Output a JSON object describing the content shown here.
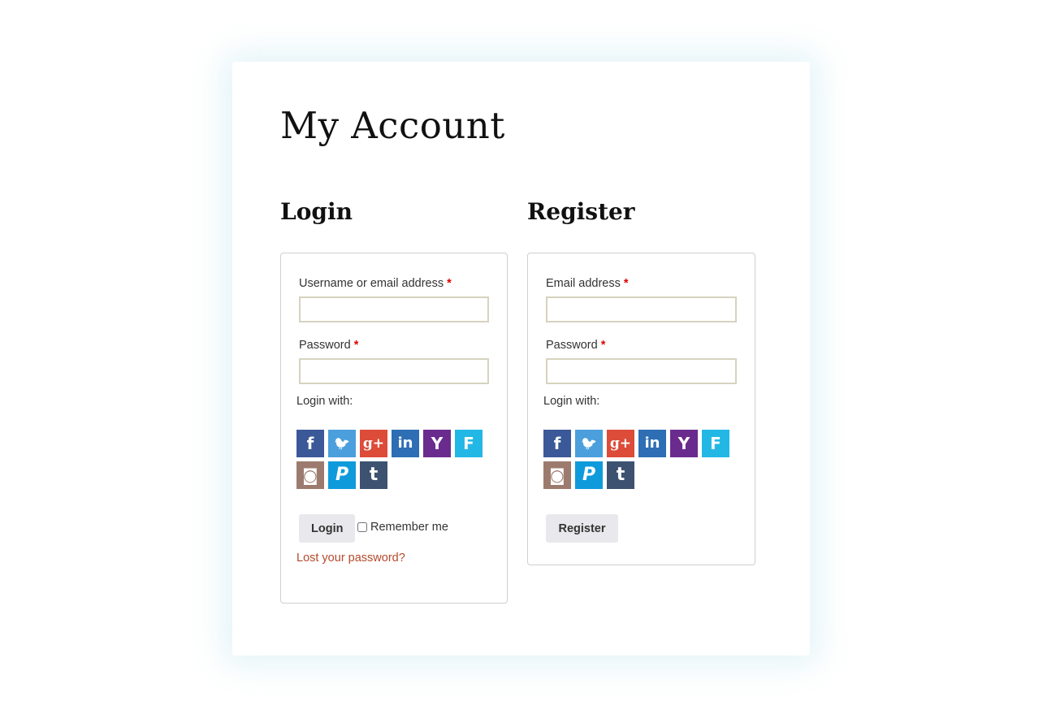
{
  "page": {
    "title": "My Account"
  },
  "login": {
    "heading": "Login",
    "username_label": "Username or email address",
    "username_value": "",
    "password_label": "Password",
    "password_value": "",
    "required_marker": "*",
    "login_with_label": "Login with:",
    "button_label": "Login",
    "remember_label": "Remember me",
    "remember_checked": false,
    "lost_password_link": "Lost your password?"
  },
  "register": {
    "heading": "Register",
    "email_label": "Email address",
    "email_value": "",
    "password_label": "Password",
    "password_value": "",
    "required_marker": "*",
    "login_with_label": "Login with:",
    "button_label": "Register"
  },
  "social_providers": [
    {
      "name": "facebook",
      "glyph": "f",
      "color": "#3b5998"
    },
    {
      "name": "twitter",
      "glyph": "🐦",
      "color": "#4a9fdc"
    },
    {
      "name": "google-plus",
      "glyph": "g+",
      "color": "#dd4b39"
    },
    {
      "name": "linkedin",
      "glyph": "in",
      "color": "#2d6eb4"
    },
    {
      "name": "yahoo",
      "glyph": "Y",
      "color": "#6a2b8e"
    },
    {
      "name": "foursquare",
      "glyph": "F",
      "color": "#23b7e5"
    },
    {
      "name": "instagram",
      "glyph": "◙",
      "color": "#9c7b6e"
    },
    {
      "name": "paypal",
      "glyph": "P",
      "color": "#0f9bdb"
    },
    {
      "name": "tumblr",
      "glyph": "t",
      "color": "#3c5270"
    }
  ],
  "colors": {
    "link": "#b5492c",
    "required": "#e00000",
    "button_bg": "#e9e8ec",
    "field_border": "#d6d3bf"
  }
}
